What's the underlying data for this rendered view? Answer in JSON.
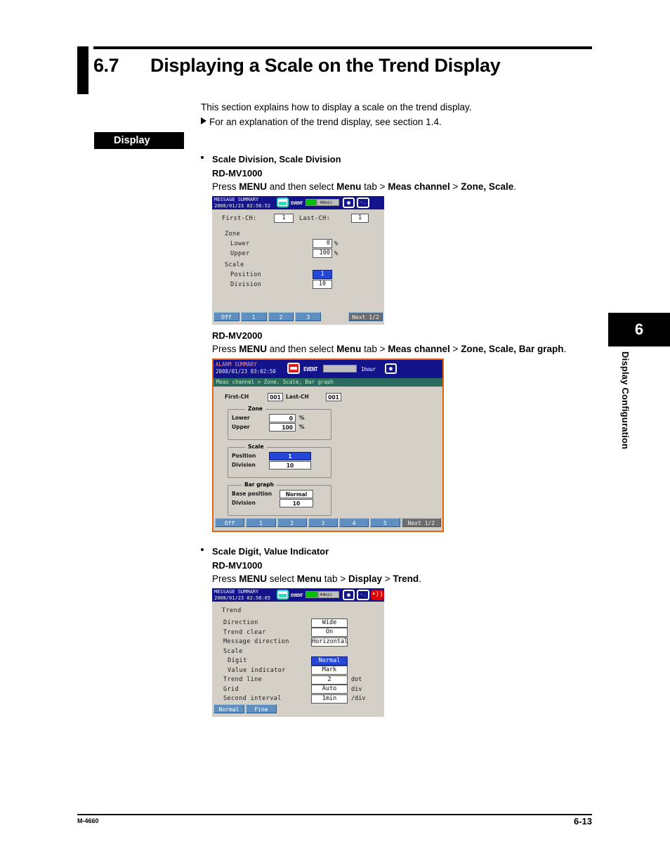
{
  "page": {
    "section_number": "6.7",
    "section_title": "Displaying a Scale on the Trend Display",
    "intro_line1": "This section explains how to display a scale on the trend display.",
    "intro_line2": "For an explanation of the trend display, see section 1.4.",
    "display_chip": "Display",
    "chapter_number": "6",
    "chapter_label": "Display Configuration",
    "footer_left": "M-4660",
    "footer_right": "6-13"
  },
  "topics": [
    {
      "bullet": "Scale Division, Scale Division",
      "model": "RD-MV1000",
      "instruction": [
        {
          "t": "Press ",
          "b": false
        },
        {
          "t": "MENU",
          "b": true
        },
        {
          "t": " and then select ",
          "b": false
        },
        {
          "t": "Menu",
          "b": true
        },
        {
          "t": " tab > ",
          "b": false
        },
        {
          "t": "Meas channel",
          "b": true
        },
        {
          "t": " > ",
          "b": false
        },
        {
          "t": "Zone, Scale",
          "b": true
        },
        {
          "t": ".",
          "b": false
        }
      ]
    },
    {
      "model": "RD-MV2000",
      "instruction": [
        {
          "t": "Press ",
          "b": false
        },
        {
          "t": "MENU",
          "b": true
        },
        {
          "t": " and then select ",
          "b": false
        },
        {
          "t": "Menu",
          "b": true
        },
        {
          "t": " tab > ",
          "b": false
        },
        {
          "t": "Meas channel",
          "b": true
        },
        {
          "t": " > ",
          "b": false
        },
        {
          "t": "Zone, Scale, Bar graph",
          "b": true
        },
        {
          "t": ".",
          "b": false
        }
      ]
    },
    {
      "bullet": "Scale Digit, Value Indicator",
      "model": "RD-MV1000",
      "instruction": [
        {
          "t": "Press ",
          "b": false
        },
        {
          "t": "MENU",
          "b": true
        },
        {
          "t": " select ",
          "b": false
        },
        {
          "t": "Menu",
          "b": true
        },
        {
          "t": " tab > ",
          "b": false
        },
        {
          "t": "Display",
          "b": true
        },
        {
          "t": " > ",
          "b": false
        },
        {
          "t": "Trend",
          "b": true
        },
        {
          "t": ".",
          "b": false
        }
      ]
    }
  ],
  "screen1": {
    "title": "MESSAGE SUMMARY",
    "timestamp": "2008/01/23 02:56:52",
    "event_label": "EVENT",
    "event_time": "46min",
    "first_ch_label": "First-CH:",
    "first_ch_value": "1",
    "last_ch_label": "Last-CH:",
    "last_ch_value": "1",
    "zone_label": "Zone",
    "lower_label": "Lower",
    "lower_value": "0",
    "lower_unit": "%",
    "upper_label": "Upper",
    "upper_value": "100",
    "upper_unit": "%",
    "scale_label": "Scale",
    "position_label": "Position",
    "position_value": "1",
    "division_label": "Division",
    "division_value": "10",
    "fkeys": [
      "Off",
      "1",
      "2",
      "3"
    ],
    "next_key": "Next 1/2"
  },
  "screen2": {
    "title": "ALARM SUMMARY",
    "timestamp": "2008/01/23 03:02:50",
    "event_label": "EVENT",
    "event_time": "1hour",
    "breadcrumb": "Meas channel > Zone, Scale, Bar graph",
    "first_ch_label": "First-CH",
    "first_ch_value": "001",
    "last_ch_label": "Last-CH",
    "last_ch_value": "001",
    "zone_caption": "Zone",
    "lower_label": "Lower",
    "lower_value": "0",
    "lower_unit": "%",
    "upper_label": "Upper",
    "upper_value": "100",
    "upper_unit": "%",
    "scale_caption": "Scale",
    "position_label": "Position",
    "position_value": "1",
    "division_label": "Division",
    "division_value": "10",
    "bar_caption": "Bar graph",
    "base_position_label": "Base position",
    "base_position_value": "Normal",
    "bar_division_label": "Division",
    "bar_division_value": "10",
    "fkeys": [
      "Off",
      "1",
      "2",
      "3",
      "4",
      "5"
    ],
    "next_key": "Next 1/2"
  },
  "screen3": {
    "title": "MESSAGE SUMMARY",
    "timestamp": "2008/01/23 02:58:05",
    "event_label": "EVENT",
    "event_time": "44min",
    "trend_label": "Trend",
    "rows": [
      {
        "label": "Direction",
        "value": "Wide",
        "unit": "",
        "sel": false,
        "indent": 1
      },
      {
        "label": "Trend clear",
        "value": "On",
        "unit": "",
        "sel": false,
        "indent": 1
      },
      {
        "label": "Message direction",
        "value": "Horizontal",
        "unit": "",
        "sel": false,
        "indent": 1
      },
      {
        "label": "Scale",
        "value": "",
        "unit": "",
        "sel": false,
        "indent": 1
      },
      {
        "label": "Digit",
        "value": "Normal",
        "unit": "",
        "sel": true,
        "indent": 2
      },
      {
        "label": "Value indicator",
        "value": "Mark",
        "unit": "",
        "sel": false,
        "indent": 2
      },
      {
        "label": "Trend line",
        "value": "2",
        "unit": "dot",
        "sel": false,
        "indent": 1
      },
      {
        "label": "Grid",
        "value": "Auto",
        "unit": "div",
        "sel": false,
        "indent": 1
      },
      {
        "label": "Second interval",
        "value": "1min",
        "unit": "/div",
        "sel": false,
        "indent": 1
      }
    ],
    "fkeys": [
      "Normal",
      "Fine"
    ]
  }
}
